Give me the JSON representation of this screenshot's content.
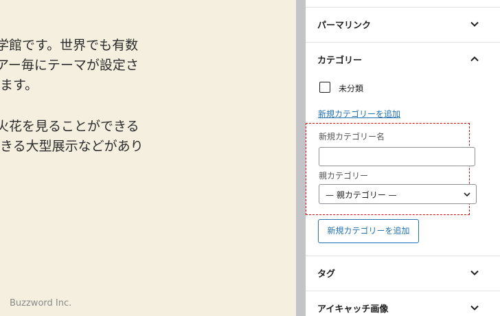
{
  "editor": {
    "paragraph1": [
      "\u0001学館です。世界でも有数",
      "\u0001アー毎にテーマが設定さ",
      "ます。"
    ],
    "paragraph2": [
      "\u0001火花を見ることができる",
      "きる大型展示などがあり"
    ],
    "brand": "Buzzword Inc."
  },
  "sidebar": {
    "permalink": "パーマリンク",
    "categories": {
      "title": "カテゴリー",
      "items": [
        {
          "label": "未分類",
          "checked": false
        }
      ],
      "add_link": "新規カテゴリーを追加",
      "new_name_label": "新規カテゴリー名",
      "new_name_value": "",
      "parent_label": "親カテゴリー",
      "parent_selected": "— 親カテゴリー —",
      "submit_label": "新規カテゴリーを追加"
    },
    "tags": "タグ",
    "featured_image": "アイキャッチ画像"
  }
}
